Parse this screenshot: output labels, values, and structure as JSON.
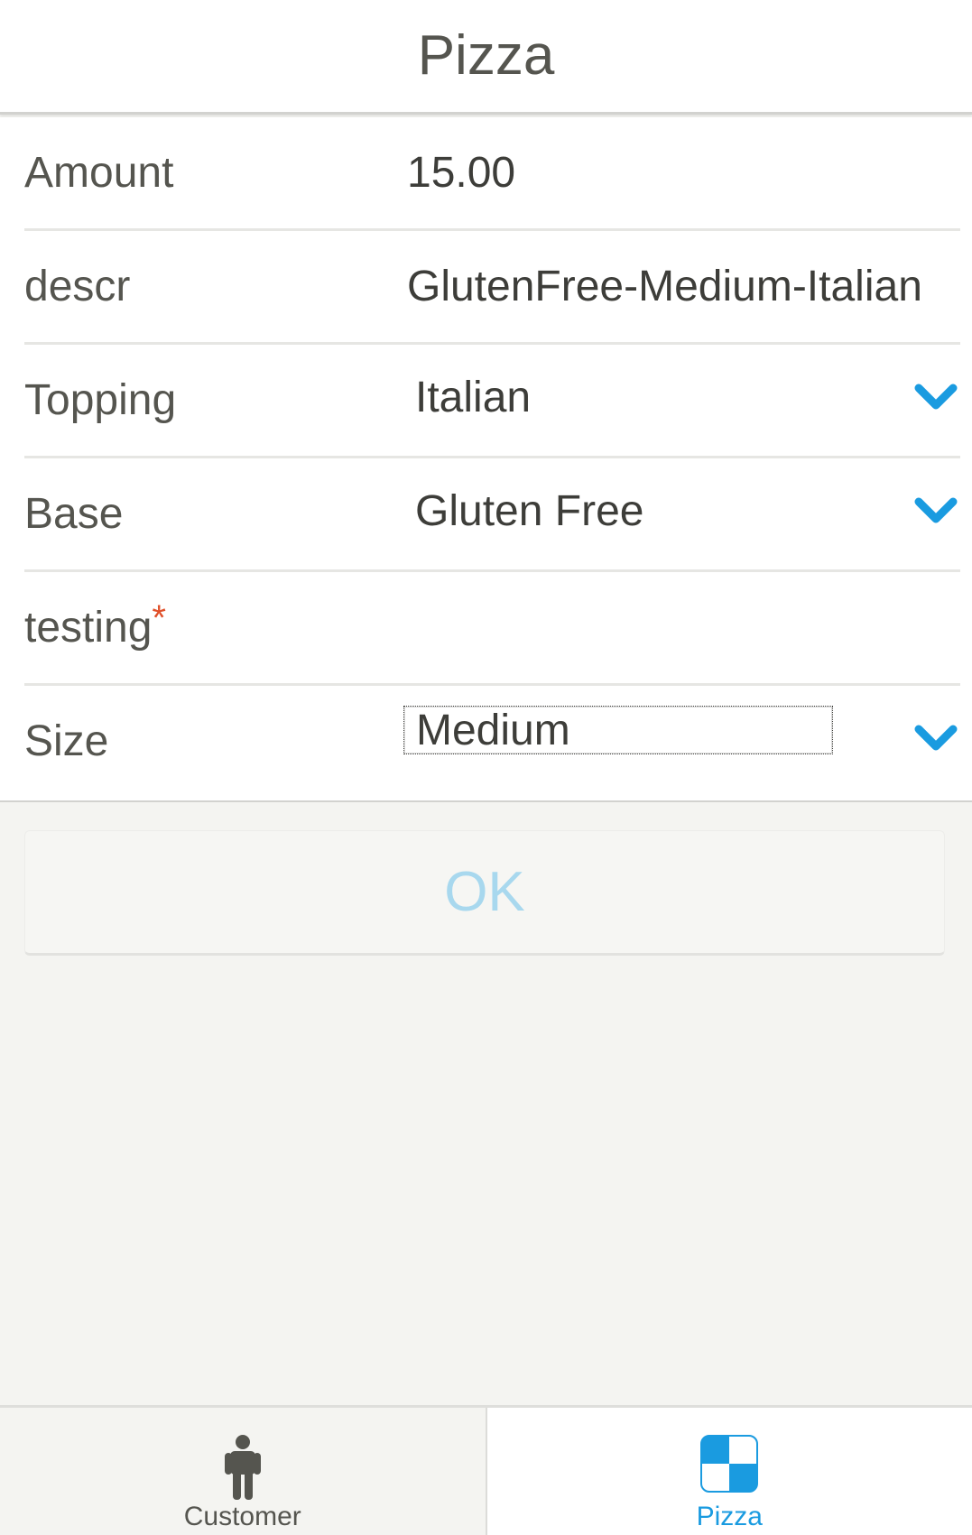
{
  "header": {
    "title": "Pizza"
  },
  "form": {
    "amount": {
      "label": "Amount",
      "value": "15.00"
    },
    "descr": {
      "label": "descr",
      "value": "GlutenFree-Medium-Italian"
    },
    "topping": {
      "label": "Topping",
      "value": "Italian"
    },
    "base": {
      "label": "Base",
      "value": "Gluten Free"
    },
    "testing": {
      "label": "testing",
      "required_marker": "*",
      "value": ""
    },
    "size": {
      "label": "Size",
      "value": "Medium"
    }
  },
  "ok_button": {
    "label": "OK"
  },
  "tabs": [
    {
      "label": "Customer",
      "icon": "person-icon",
      "active": false
    },
    {
      "label": "Pizza",
      "icon": "pizza-grid-icon",
      "active": true
    }
  ],
  "colors": {
    "accent": "#1a9be0",
    "required": "#e0502a",
    "ok_text": "#a8d8ee",
    "text": "#55554f"
  }
}
